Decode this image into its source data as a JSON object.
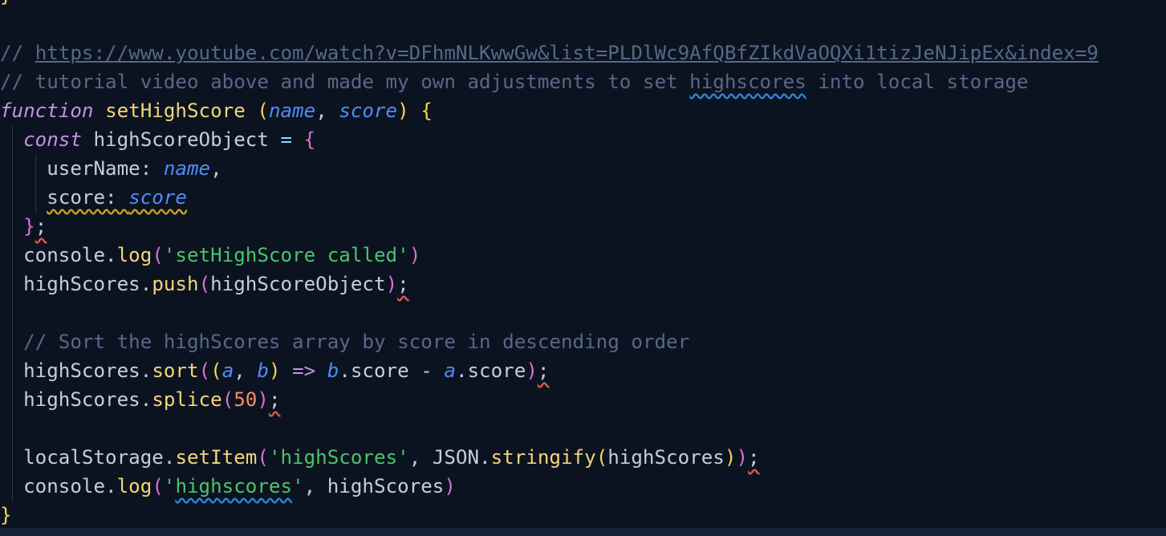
{
  "editor": {
    "lines": [
      [
        {
          "t": "}",
          "c": "t-brace"
        }
      ],
      [],
      [
        {
          "t": "// ",
          "c": "t-comment"
        },
        {
          "t": "https://www.youtube.com/watch?v=DFhmNLKwwGw&list=PLDlWc9AfQBfZIkdVaOQXi1tizJeNJipEx&index=9",
          "c": "t-comment-url"
        }
      ],
      [
        {
          "t": "// tutorial video above and made my own adjustments to set ",
          "c": "t-comment"
        },
        {
          "t": "highscores",
          "c": "t-comment squiggle-blue"
        },
        {
          "t": " into local storage",
          "c": "t-comment"
        }
      ],
      [
        {
          "t": "function",
          "c": "t-kw"
        },
        {
          "t": " ",
          "c": "t-punc"
        },
        {
          "t": "setHighScore",
          "c": "t-fn"
        },
        {
          "t": " ",
          "c": "t-punc"
        },
        {
          "t": "(",
          "c": "t-brace"
        },
        {
          "t": "name",
          "c": "t-param"
        },
        {
          "t": ", ",
          "c": "t-punc"
        },
        {
          "t": "score",
          "c": "t-param"
        },
        {
          "t": ")",
          "c": "t-brace"
        },
        {
          "t": " ",
          "c": "t-punc"
        },
        {
          "t": "{",
          "c": "t-brace"
        }
      ],
      [
        {
          "t": "  ",
          "c": "t-punc"
        },
        {
          "t": "const",
          "c": "t-kw"
        },
        {
          "t": " highScoreObject ",
          "c": "t-ident"
        },
        {
          "t": "=",
          "c": "t-op"
        },
        {
          "t": " ",
          "c": "t-punc"
        },
        {
          "t": "{",
          "c": "t-brace2"
        }
      ],
      [
        {
          "t": "    userName: ",
          "c": "t-prop"
        },
        {
          "t": "name",
          "c": "t-param"
        },
        {
          "t": ",",
          "c": "t-punc"
        }
      ],
      [
        {
          "t": "    ",
          "c": "t-punc"
        },
        {
          "t": "score: ",
          "c": "t-prop squiggle-yellow"
        },
        {
          "t": "score",
          "c": "t-param squiggle-yellow"
        }
      ],
      [
        {
          "t": "  ",
          "c": "t-punc"
        },
        {
          "t": "}",
          "c": "t-brace2"
        },
        {
          "t": ";",
          "c": "t-punc squiggle-red"
        }
      ],
      [
        {
          "t": "  console.",
          "c": "t-ident"
        },
        {
          "t": "log",
          "c": "t-method"
        },
        {
          "t": "(",
          "c": "t-brace2"
        },
        {
          "t": "'setHighScore called'",
          "c": "t-str"
        },
        {
          "t": ")",
          "c": "t-brace2"
        }
      ],
      [
        {
          "t": "  highScores.",
          "c": "t-ident"
        },
        {
          "t": "push",
          "c": "t-method"
        },
        {
          "t": "(",
          "c": "t-brace2"
        },
        {
          "t": "highScoreObject",
          "c": "t-ident"
        },
        {
          "t": ")",
          "c": "t-brace2"
        },
        {
          "t": ";",
          "c": "t-punc squiggle-red"
        }
      ],
      [],
      [
        {
          "t": "  // Sort the highScores array by score in descending order",
          "c": "t-comment"
        }
      ],
      [
        {
          "t": "  highScores.",
          "c": "t-ident"
        },
        {
          "t": "sort",
          "c": "t-method"
        },
        {
          "t": "(",
          "c": "t-brace2"
        },
        {
          "t": "(",
          "c": "t-brace"
        },
        {
          "t": "a",
          "c": "t-param"
        },
        {
          "t": ", ",
          "c": "t-punc"
        },
        {
          "t": "b",
          "c": "t-param"
        },
        {
          "t": ")",
          "c": "t-brace"
        },
        {
          "t": " ",
          "c": "t-punc"
        },
        {
          "t": "=>",
          "c": "t-kw"
        },
        {
          "t": " ",
          "c": "t-punc"
        },
        {
          "t": "b",
          "c": "t-param"
        },
        {
          "t": ".score ",
          "c": "t-ident"
        },
        {
          "t": "-",
          "c": "t-op"
        },
        {
          "t": " ",
          "c": "t-punc"
        },
        {
          "t": "a",
          "c": "t-param"
        },
        {
          "t": ".score",
          "c": "t-ident"
        },
        {
          "t": ")",
          "c": "t-brace2"
        },
        {
          "t": ";",
          "c": "t-punc squiggle-red"
        }
      ],
      [
        {
          "t": "  highScores.",
          "c": "t-ident"
        },
        {
          "t": "splice",
          "c": "t-method"
        },
        {
          "t": "(",
          "c": "t-brace2"
        },
        {
          "t": "50",
          "c": "t-num"
        },
        {
          "t": ")",
          "c": "t-brace2"
        },
        {
          "t": ";",
          "c": "t-punc squiggle-red"
        }
      ],
      [],
      [
        {
          "t": "  localStorage.",
          "c": "t-ident"
        },
        {
          "t": "setItem",
          "c": "t-method"
        },
        {
          "t": "(",
          "c": "t-brace2"
        },
        {
          "t": "'highScores'",
          "c": "t-str"
        },
        {
          "t": ", JSON.",
          "c": "t-ident"
        },
        {
          "t": "stringify",
          "c": "t-method"
        },
        {
          "t": "(",
          "c": "t-brace"
        },
        {
          "t": "highScores",
          "c": "t-ident"
        },
        {
          "t": ")",
          "c": "t-brace"
        },
        {
          "t": ")",
          "c": "t-brace2"
        },
        {
          "t": ";",
          "c": "t-punc squiggle-red"
        }
      ],
      [
        {
          "t": "  console.",
          "c": "t-ident"
        },
        {
          "t": "log",
          "c": "t-method"
        },
        {
          "t": "(",
          "c": "t-brace2"
        },
        {
          "t": "'",
          "c": "t-str"
        },
        {
          "t": "highscores",
          "c": "t-str squiggle-blue"
        },
        {
          "t": "'",
          "c": "t-str"
        },
        {
          "t": ", highScores",
          "c": "t-ident"
        },
        {
          "t": ")",
          "c": "t-brace2"
        }
      ],
      [
        {
          "t": "}",
          "c": "t-brace"
        }
      ]
    ]
  },
  "colors": {
    "background": "#0c1320",
    "comment": "#566889",
    "keyword": "#c78fe9",
    "function": "#f2d47a",
    "parameter": "#4f8cf6",
    "string": "#4cc36a",
    "number": "#f78c6c",
    "bracket_gold": "#f7d64a",
    "bracket_magenta": "#da70d6"
  }
}
